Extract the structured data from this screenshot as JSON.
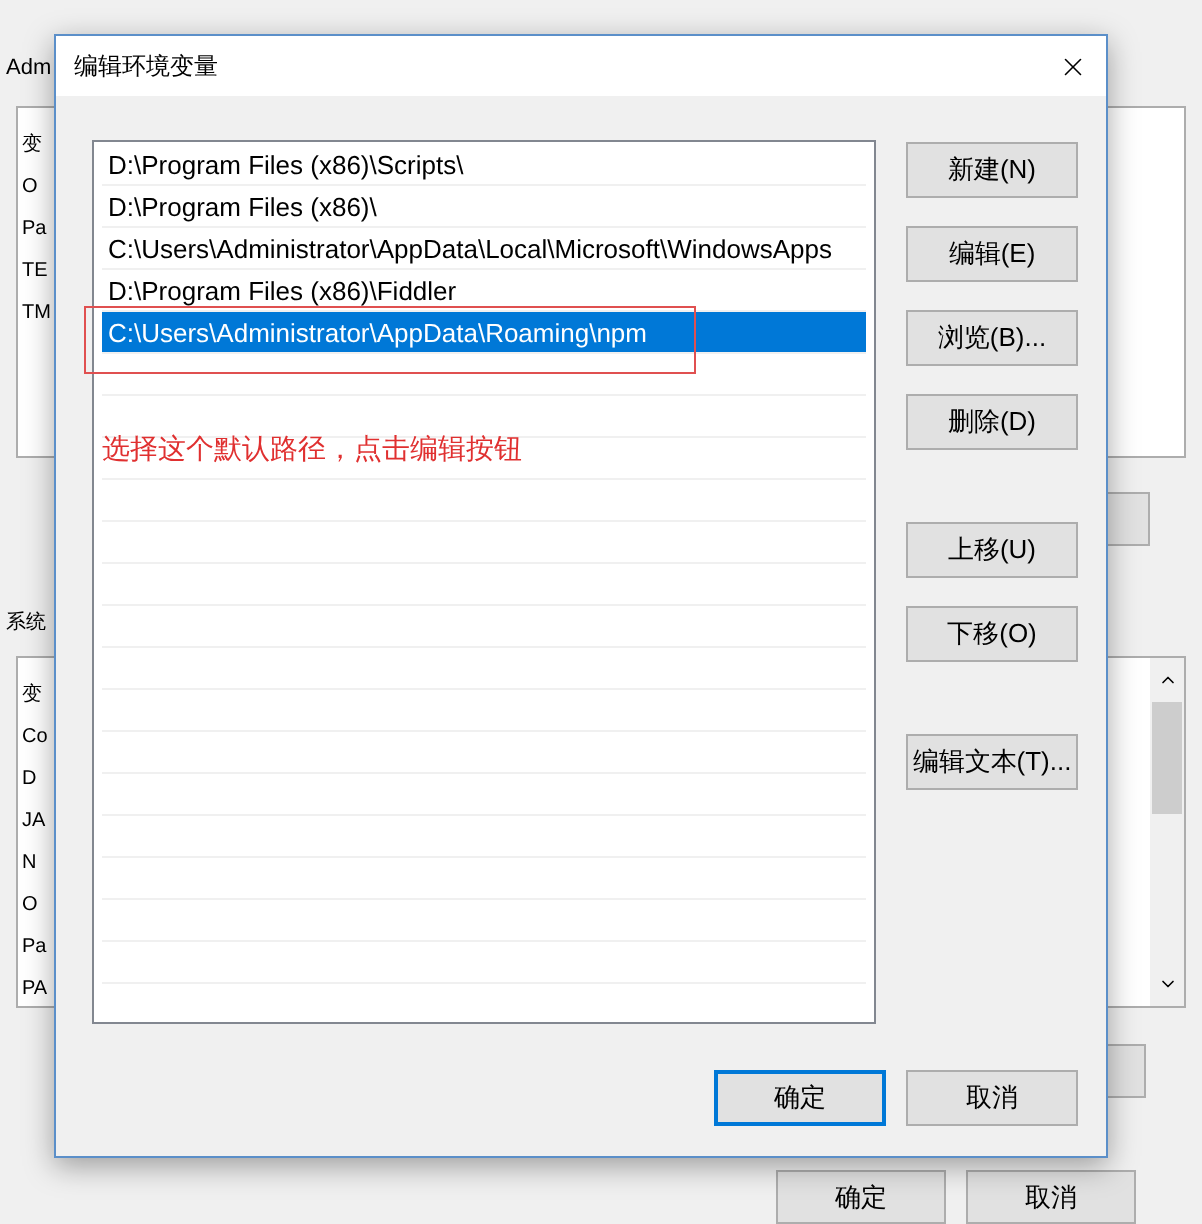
{
  "background_window": {
    "user_section_label": "Adm",
    "user_list": [
      "变",
      "O",
      "Pa",
      "TE",
      "TM"
    ],
    "system_section_label": "系统",
    "system_list": [
      "变",
      "Co",
      "D",
      "JA",
      "N",
      "O",
      "Pa",
      "PA"
    ],
    "buttons": [
      "确定",
      "取消"
    ]
  },
  "dialog": {
    "title": "编辑环境变量",
    "paths": [
      {
        "text": "D:\\Program Files (x86)\\Scripts\\",
        "selected": false
      },
      {
        "text": "D:\\Program Files (x86)\\",
        "selected": false
      },
      {
        "text": "C:\\Users\\Administrator\\AppData\\Local\\Microsoft\\WindowsApps",
        "selected": false
      },
      {
        "text": "D:\\Program Files (x86)\\Fiddler",
        "selected": false
      },
      {
        "text": "C:\\Users\\Administrator\\AppData\\Roaming\\npm",
        "selected": true
      }
    ],
    "side_button_groups": [
      [
        "新建(N)",
        "编辑(E)",
        "浏览(B)...",
        "删除(D)"
      ],
      [
        "上移(U)",
        "下移(O)"
      ],
      [
        "编辑文本(T)..."
      ]
    ],
    "buttons": [
      {
        "label": "确定",
        "default": true
      },
      {
        "label": "取消",
        "default": false
      }
    ]
  },
  "annotation": {
    "text": "选择这个默认路径，点击编辑按钮"
  }
}
